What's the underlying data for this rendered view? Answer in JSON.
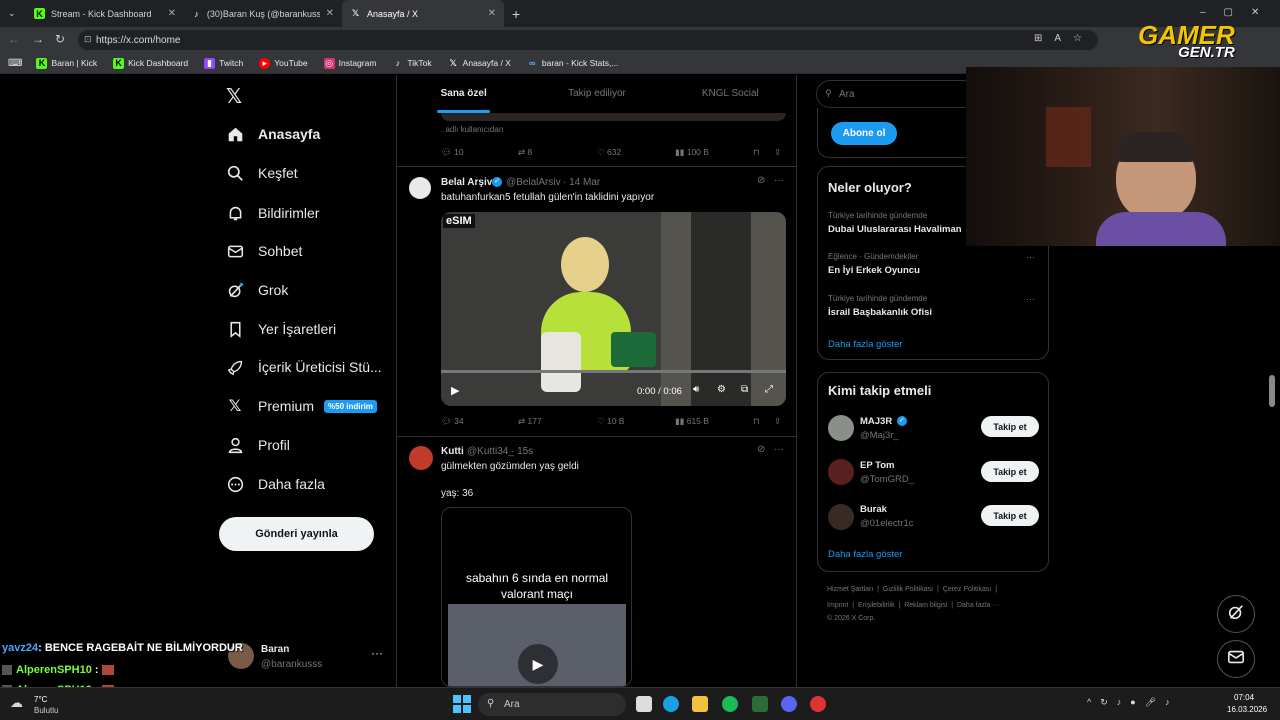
{
  "browser": {
    "tabs": [
      {
        "label": "Stream - Kick Dashboard",
        "icon": "kick-icon"
      },
      {
        "label": "(30)Baran Kuş (@barankusss) | Tik",
        "icon": "tiktok-icon"
      },
      {
        "label": "Anasayfa / X",
        "icon": "x-icon"
      }
    ],
    "url": "https://x.com/home",
    "bookmarks": [
      {
        "label": "Baran | Kick",
        "icon": "kick-icon"
      },
      {
        "label": "Kick Dashboard",
        "icon": "kick-icon"
      },
      {
        "label": "Twitch",
        "icon": "twitch-icon"
      },
      {
        "label": "YouTube",
        "icon": "youtube-icon"
      },
      {
        "label": "Instagram",
        "icon": "instagram-icon"
      },
      {
        "label": "TikTok",
        "icon": "tiktok-icon"
      },
      {
        "label": "Anasayfa / X",
        "icon": "x-icon"
      },
      {
        "label": "baran - Kick Stats,...",
        "icon": "stats-icon"
      }
    ]
  },
  "watermark": {
    "line1": "GAMER",
    "line2": "GEN.TR"
  },
  "sidebar": {
    "items": [
      {
        "label": "Anasayfa",
        "icon": "home-icon"
      },
      {
        "label": "Keşfet",
        "icon": "search-icon"
      },
      {
        "label": "Bildirimler",
        "icon": "bell-icon"
      },
      {
        "label": "Sohbet",
        "icon": "mail-icon"
      },
      {
        "label": "Grok",
        "icon": "grok-icon"
      },
      {
        "label": "Yer İşaretleri",
        "icon": "bookmark-icon"
      },
      {
        "label": "İçerik Üreticisi Stü...",
        "icon": "rocket-icon"
      },
      {
        "label": "Premium",
        "icon": "x-premium-icon",
        "badge": "%50 indirim"
      },
      {
        "label": "Profil",
        "icon": "person-icon"
      },
      {
        "label": "Daha fazla",
        "icon": "more-circle-icon"
      }
    ],
    "post_button": "Gönderi yayınla",
    "account": {
      "name": "Baran",
      "handle": "@barankusss"
    }
  },
  "feed": {
    "tabs": [
      "Sana özel",
      "Takip ediliyor",
      "KNGL Social"
    ],
    "top_snippet": ". adlı kullanıcıdan",
    "top_actions": {
      "replies": "10",
      "reposts": "8",
      "likes": "632",
      "views": "100 B"
    },
    "tweets": [
      {
        "name": "Belal Arşiv",
        "handle": "@BelalArsiv",
        "time": "· 14 Mar",
        "text": "batuhanfurkan5 fetullah gülen'in taklidini yapıyor",
        "video_overlay": "eSIM",
        "video_time": "0:00 / 0:06",
        "actions": {
          "replies": "34",
          "reposts": "177",
          "likes": "10 B",
          "views": "615 B"
        }
      },
      {
        "name": "Kutti",
        "handle": "@Kutti34_",
        "time": "· 15s",
        "text": "gülmekten gözümden yaş geldi",
        "text2": "yaş: 36",
        "card_text": "sabahın 6 sında en normal valorant maçı"
      }
    ]
  },
  "right": {
    "search_placeholder": "Ara",
    "subscribe_button": "Abone ol",
    "trends_title": "Neler oluyor?",
    "trends": [
      {
        "context": "Türkiye tarihinde gündemde",
        "name": "Dubai Uluslararası Havaliman"
      },
      {
        "context": "Eğlence · Gündemdekiler",
        "name": "En İyi Erkek Oyuncu"
      },
      {
        "context": "Türkiye tarihinde gündemde",
        "name": "İsrail Başbakanlık Ofisi"
      }
    ],
    "show_more": "Daha fazla göster",
    "follow_title": "Kimi takip etmeli",
    "follow": [
      {
        "name": "MAJ3R",
        "handle": "@Maj3r_",
        "button": "Takip et"
      },
      {
        "name": "EP Tom",
        "handle": "@TomGRD_",
        "button": "Takip et"
      },
      {
        "name": "Burak",
        "handle": "@01electr1c",
        "button": "Takip et"
      }
    ],
    "footer": {
      "line1": [
        "Hizmet Şartları",
        "Gizlilik Politikası",
        "Çerez Politikası"
      ],
      "line2": [
        "Imprint",
        "Erişilebilirlik",
        "Reklam bilgisi",
        "Daha fazla ···"
      ],
      "copyright": "© 2026 X Corp."
    }
  },
  "chat": [
    {
      "user": "yavz24",
      "message": ": BENCE RAGEBAİT NE BİLMİYORDUR",
      "color": "#4aa3ff"
    },
    {
      "user": "AlperenSPH10",
      "message": ":",
      "color": "#7cfc3a"
    },
    {
      "user": "AlperenSPH10",
      "message": ":",
      "color": "#7cfc3a"
    }
  ],
  "taskbar": {
    "weather_temp": "7°C",
    "weather_desc": "Bulutlu",
    "search": "Ara",
    "time": "07:04",
    "date": "16.03.2026"
  }
}
